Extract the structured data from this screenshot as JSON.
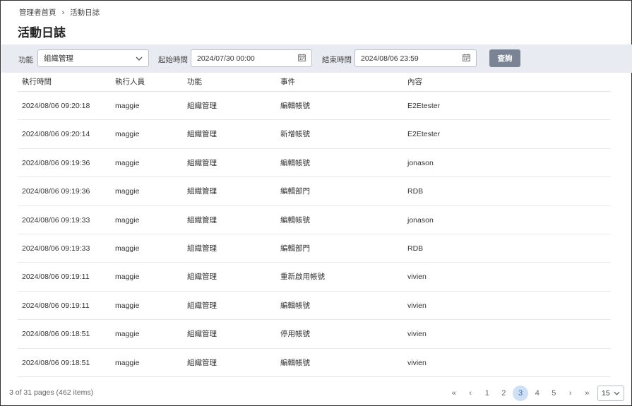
{
  "breadcrumb": {
    "home": "管理者首頁",
    "separator": "›",
    "current": "活動日誌"
  },
  "page_title": "活動日誌",
  "filters": {
    "function_label": "功能",
    "function_value": "組織管理",
    "start_label": "起始時間",
    "start_value": "2024/07/30 00:00",
    "end_label": "結束時間",
    "end_value": "2024/08/06 23:59",
    "query_label": "查詢"
  },
  "table": {
    "headers": [
      "執行時間",
      "執行人員",
      "功能",
      "事件",
      "內容"
    ],
    "rows": [
      [
        "2024/08/06 09:20:18",
        "maggie",
        "組織管理",
        "編輯帳號",
        "E2Etester"
      ],
      [
        "2024/08/06 09:20:14",
        "maggie",
        "組織管理",
        "新增帳號",
        "E2Etester"
      ],
      [
        "2024/08/06 09:19:36",
        "maggie",
        "組織管理",
        "編輯帳號",
        "jonason"
      ],
      [
        "2024/08/06 09:19:36",
        "maggie",
        "組織管理",
        "編輯部門",
        "RDB"
      ],
      [
        "2024/08/06 09:19:33",
        "maggie",
        "組織管理",
        "編輯帳號",
        "jonason"
      ],
      [
        "2024/08/06 09:19:33",
        "maggie",
        "組織管理",
        "編輯部門",
        "RDB"
      ],
      [
        "2024/08/06 09:19:11",
        "maggie",
        "組織管理",
        "重新啟用帳號",
        "vivien"
      ],
      [
        "2024/08/06 09:19:11",
        "maggie",
        "組織管理",
        "編輯帳號",
        "vivien"
      ],
      [
        "2024/08/06 09:18:51",
        "maggie",
        "組織管理",
        "停用帳號",
        "vivien"
      ],
      [
        "2024/08/06 09:18:51",
        "maggie",
        "組織管理",
        "編輯帳號",
        "vivien"
      ]
    ]
  },
  "footer": {
    "info": "3 of 31 pages (462 items)",
    "pager": {
      "first": "«",
      "prev": "‹",
      "pages": [
        "1",
        "2",
        "3",
        "4",
        "5"
      ],
      "active_page": "3",
      "next": "›",
      "last": "»"
    },
    "page_size": "15"
  },
  "icons": {
    "dropdown": "chevron-down-icon",
    "calendar": "calendar-icon"
  },
  "colors": {
    "filter_bar": "#e8ebf1",
    "query_button": "#7b8495",
    "active_page_bg": "#cfe0f5"
  }
}
